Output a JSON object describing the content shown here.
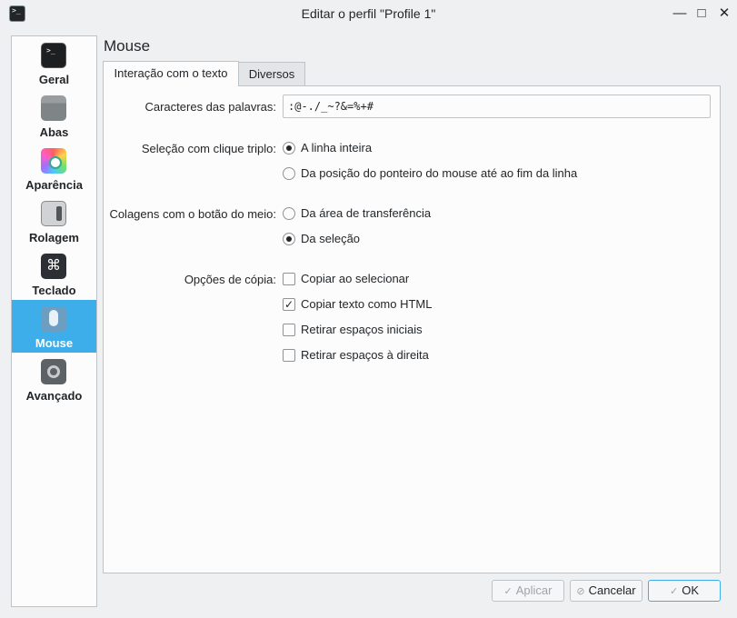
{
  "window": {
    "title": "Editar o perfil \"Profile 1\"",
    "minimize": "—",
    "maximize": "□",
    "close": "✕"
  },
  "sidebar": {
    "items": [
      {
        "label": "Geral",
        "icon": "terminal-icon"
      },
      {
        "label": "Abas",
        "icon": "tabs-icon"
      },
      {
        "label": "Aparência",
        "icon": "appearance-icon"
      },
      {
        "label": "Rolagem",
        "icon": "scrollbar-icon"
      },
      {
        "label": "Teclado",
        "icon": "keyboard-icon"
      },
      {
        "label": "Mouse",
        "icon": "mouse-icon",
        "active": true
      },
      {
        "label": "Avançado",
        "icon": "advanced-icon"
      }
    ],
    "teclado_glyph": "⌘"
  },
  "page": {
    "title": "Mouse"
  },
  "tabs": [
    {
      "label": "Interação com o texto",
      "active": true
    },
    {
      "label": "Diversos",
      "active": false
    }
  ],
  "form": {
    "word_chars": {
      "label": "Caracteres das palavras:",
      "value": ":@-./_~?&=%+#"
    },
    "triple_click": {
      "label": "Seleção com clique triplo:",
      "options": [
        {
          "label": "A linha inteira",
          "checked": true
        },
        {
          "label": "Da posição do ponteiro do mouse até ao fim da linha",
          "checked": false
        }
      ]
    },
    "middle_paste": {
      "label": "Colagens com o botão do meio:",
      "options": [
        {
          "label": "Da área de transferência",
          "checked": false
        },
        {
          "label": "Da seleção",
          "checked": true
        }
      ]
    },
    "copy_options": {
      "label": "Opções de cópia:",
      "options": [
        {
          "label": "Copiar ao selecionar",
          "checked": false
        },
        {
          "label": "Copiar texto como HTML",
          "checked": true
        },
        {
          "label": "Retirar espaços iniciais",
          "checked": false
        },
        {
          "label": "Retirar espaços à direita",
          "checked": false
        }
      ],
      "check_glyph": "✓"
    }
  },
  "buttons": {
    "apply": "Aplicar",
    "cancel": "Cancelar",
    "ok": "OK",
    "apply_icon_glyph": "✓",
    "cancel_icon_glyph": "⊘",
    "ok_icon_glyph": "✓"
  },
  "colors": {
    "accent": "#3daee9",
    "window_bg": "#eff0f1",
    "panel_bg": "#fcfcfc"
  }
}
